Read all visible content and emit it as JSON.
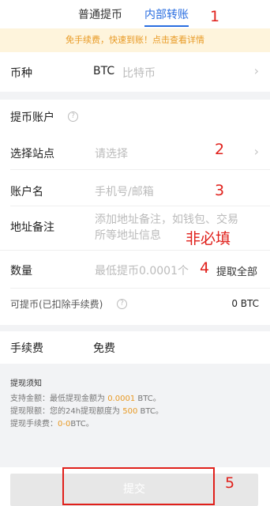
{
  "tabs": [
    {
      "label": "普通提币"
    },
    {
      "label": "内部转账"
    }
  ],
  "banner": {
    "text": "免手续费，快速到账！点击查看详情"
  },
  "currency": {
    "label": "币种",
    "code": "BTC",
    "name": "比特币"
  },
  "account_section": {
    "label": "提币账户"
  },
  "site": {
    "label": "选择站点",
    "placeholder": "请选择"
  },
  "account": {
    "label": "账户名",
    "placeholder": "手机号/邮箱"
  },
  "remark": {
    "label": "地址备注",
    "placeholder_line1": "添加地址备注，如钱包、交易",
    "placeholder_line2": "所等地址信息"
  },
  "quantity": {
    "label": "数量",
    "placeholder": "最低提币0.0001个",
    "withdraw_all": "提取全部"
  },
  "available": {
    "label": "可提币(已扣除手续费)",
    "value": "0 BTC"
  },
  "fee": {
    "label": "手续费",
    "value": "免费"
  },
  "notice": {
    "title": "提现须知",
    "line1_prefix": "支持金额：最低提现金额为 ",
    "line1_value": "0.0001",
    "line1_suffix": " BTC。",
    "line2_prefix": "提现限额：您的24h提现额度为 ",
    "line2_value": "500",
    "line2_suffix": " BTC。",
    "line3_prefix": "提现手续费：",
    "line3_value": "0-0",
    "line3_suffix": "BTC。"
  },
  "submit": {
    "label": "提交"
  },
  "annotations": {
    "a1": "1",
    "a2": "2",
    "a3": "3",
    "a4": "4",
    "a5": "5",
    "optional": "非必填"
  },
  "icons": {
    "chevron": "chevron-right-icon",
    "help": "help-circle-icon"
  },
  "colors": {
    "accent": "#2a6ee0",
    "highlight": "#e89a25",
    "annotation": "#e0201b"
  }
}
